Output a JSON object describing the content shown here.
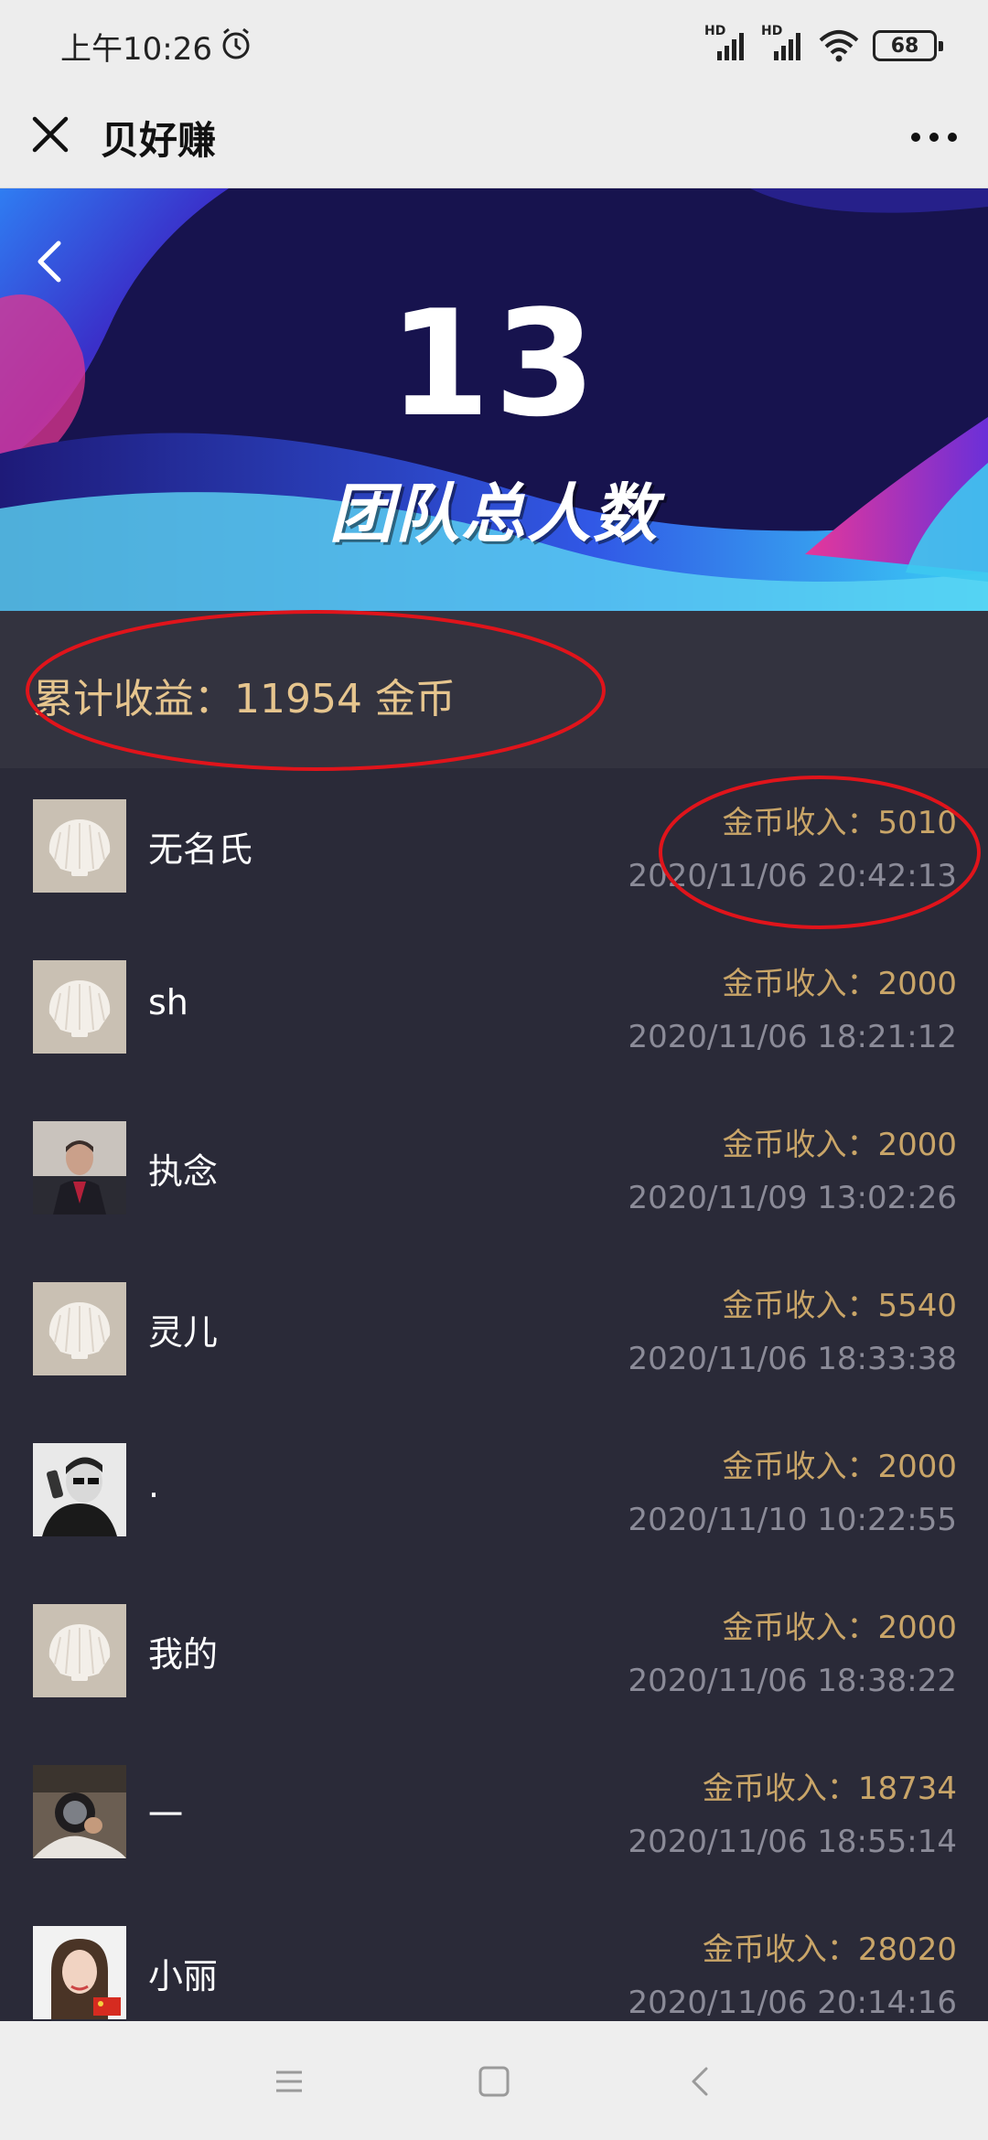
{
  "status_bar": {
    "time": "上午10:26",
    "battery": "68",
    "signal_1": "HD",
    "signal_2": "HD"
  },
  "title_bar": {
    "title": "贝好赚"
  },
  "banner": {
    "team_count": "13",
    "team_label": "团队总人数"
  },
  "summary": {
    "text": "累计收益：11954 金币"
  },
  "members": [
    {
      "name": "无名氏",
      "income": "金币收入：5010",
      "time": "2020/11/06 20:42:13",
      "avatar": "shell-avatar"
    },
    {
      "name": "sh",
      "income": "金币收入：2000",
      "time": "2020/11/06 18:21:12",
      "avatar": "shell-avatar"
    },
    {
      "name": "执念",
      "income": "金币收入：2000",
      "time": "2020/11/09 13:02:26",
      "avatar": "photo-avatar"
    },
    {
      "name": "灵儿",
      "income": "金币收入：5540",
      "time": "2020/11/06 18:33:38",
      "avatar": "shell-avatar"
    },
    {
      "name": ".",
      "income": "金币收入：2000",
      "time": "2020/11/10 10:22:55",
      "avatar": "photo-avatar"
    },
    {
      "name": "我的",
      "income": "金币收入：2000",
      "time": "2020/11/06 18:38:22",
      "avatar": "shell-avatar"
    },
    {
      "name": "一",
      "income": "金币收入：18734",
      "time": "2020/11/06 18:55:14",
      "avatar": "photo-avatar"
    },
    {
      "name": "小丽",
      "income": "金币收入：28020",
      "time": "2020/11/06 20:14:16",
      "avatar": "photo-avatar"
    }
  ],
  "colors": {
    "gold": "#e6c58e",
    "income": "#c9a568",
    "list_bg": "#2a2a38",
    "annotation": "#e0141b"
  }
}
